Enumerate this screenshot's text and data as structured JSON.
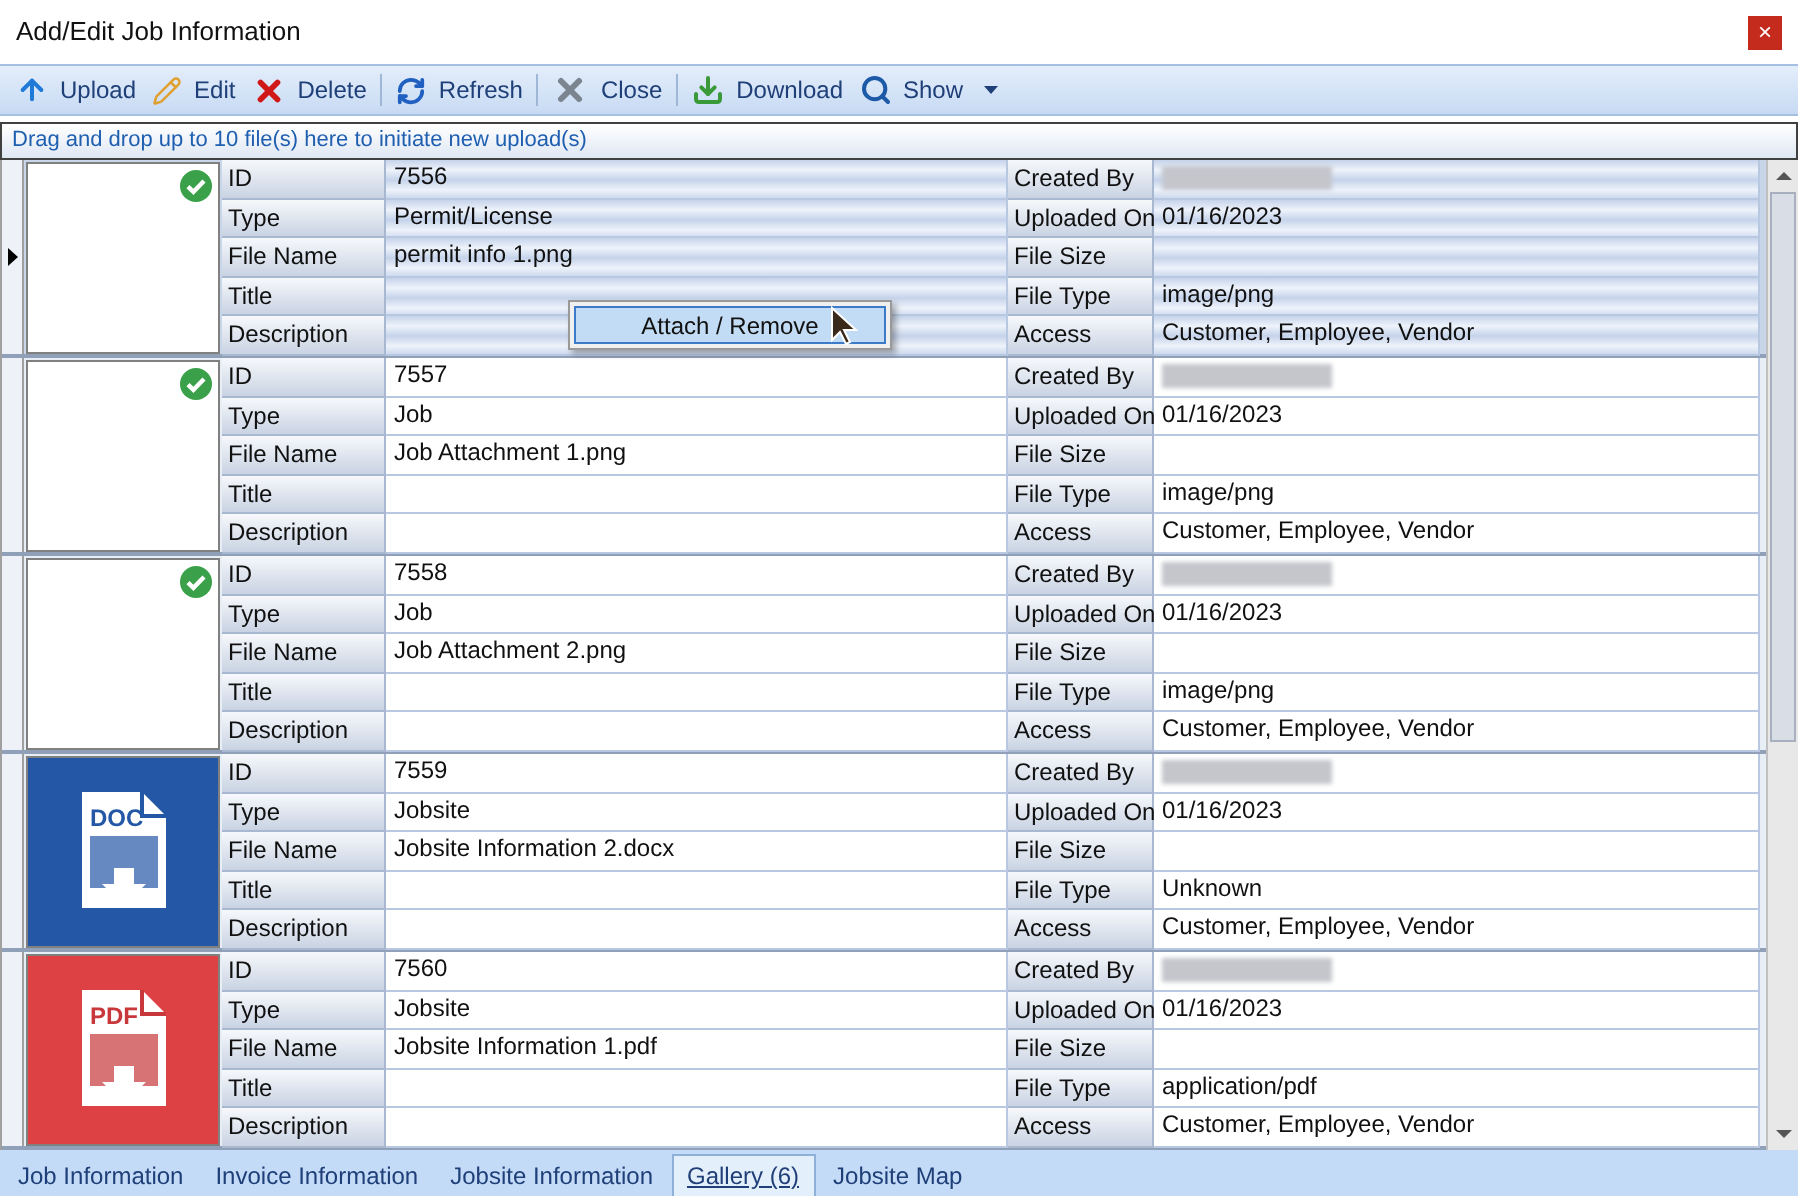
{
  "window": {
    "title": "Add/Edit Job Information",
    "close_glyph": "×"
  },
  "toolbar": {
    "groups": [
      {
        "buttons": [
          {
            "label": "Upload",
            "dropdown": false
          },
          {
            "label": "Edit",
            "dropdown": false
          },
          {
            "label": "Delete",
            "dropdown": false
          }
        ]
      },
      {
        "buttons": [
          {
            "label": "Refresh",
            "dropdown": false
          }
        ]
      },
      {
        "buttons": [
          {
            "label": "Close",
            "dropdown": false
          }
        ]
      },
      {
        "buttons": [
          {
            "label": "Download",
            "dropdown": false
          },
          {
            "label": "Show",
            "dropdown": true
          }
        ]
      }
    ]
  },
  "drop_hint": "Drag and drop up to 10 file(s) here to initiate new upload(s)",
  "records": [
    {
      "selected": true,
      "thumbnail": {
        "kind": "image",
        "attached": true
      },
      "left": [
        {
          "label": "ID",
          "value": "7556"
        },
        {
          "label": "Type",
          "value": "Permit/License"
        },
        {
          "label": "File Name",
          "value": "permit info 1.png"
        },
        {
          "label": "Title"
        },
        {
          "label": "Description"
        }
      ],
      "right": [
        {
          "label": "Created By",
          "redacted": true
        },
        {
          "label": "Uploaded On",
          "value": "01/16/2023"
        },
        {
          "label": "File Size"
        },
        {
          "label": "File Type",
          "value": "image/png"
        },
        {
          "label": "Access",
          "value": "Customer, Employee, Vendor"
        }
      ]
    },
    {
      "selected": false,
      "thumbnail": {
        "kind": "image",
        "attached": true
      },
      "left": [
        {
          "label": "ID",
          "value": "7557"
        },
        {
          "label": "Type",
          "value": "Job"
        },
        {
          "label": "File Name",
          "value": "Job Attachment 1.png"
        },
        {
          "label": "Title"
        },
        {
          "label": "Description"
        }
      ],
      "right": [
        {
          "label": "Created By",
          "redacted": true
        },
        {
          "label": "Uploaded On",
          "value": "01/16/2023"
        },
        {
          "label": "File Size"
        },
        {
          "label": "File Type",
          "value": "image/png"
        },
        {
          "label": "Access",
          "value": "Customer, Employee, Vendor"
        }
      ]
    },
    {
      "selected": false,
      "thumbnail": {
        "kind": "image",
        "attached": true
      },
      "left": [
        {
          "label": "ID",
          "value": "7558"
        },
        {
          "label": "Type",
          "value": "Job"
        },
        {
          "label": "File Name",
          "value": "Job Attachment 2.png"
        },
        {
          "label": "Title"
        },
        {
          "label": "Description"
        }
      ],
      "right": [
        {
          "label": "Created By",
          "redacted": true
        },
        {
          "label": "Uploaded On",
          "value": "01/16/2023"
        },
        {
          "label": "File Size"
        },
        {
          "label": "File Type",
          "value": "image/png"
        },
        {
          "label": "Access",
          "value": "Customer, Employee, Vendor"
        }
      ]
    },
    {
      "selected": false,
      "thumbnail": {
        "kind": "doc",
        "badge": "DOC",
        "attached": false
      },
      "left": [
        {
          "label": "ID",
          "value": "7559"
        },
        {
          "label": "Type",
          "value": "Jobsite"
        },
        {
          "label": "File Name",
          "value": "Jobsite Information 2.docx"
        },
        {
          "label": "Title"
        },
        {
          "label": "Description"
        }
      ],
      "right": [
        {
          "label": "Created By",
          "redacted": true
        },
        {
          "label": "Uploaded On",
          "value": "01/16/2023"
        },
        {
          "label": "File Size"
        },
        {
          "label": "File Type",
          "value": "Unknown"
        },
        {
          "label": "Access",
          "value": "Customer, Employee, Vendor"
        }
      ]
    },
    {
      "selected": false,
      "thumbnail": {
        "kind": "pdf",
        "badge": "PDF",
        "attached": false
      },
      "left": [
        {
          "label": "ID",
          "value": "7560"
        },
        {
          "label": "Type",
          "value": "Jobsite"
        },
        {
          "label": "File Name",
          "value": "Jobsite Information 1.pdf"
        },
        {
          "label": "Title"
        },
        {
          "label": "Description"
        }
      ],
      "right": [
        {
          "label": "Created By",
          "redacted": true
        },
        {
          "label": "Uploaded On",
          "value": "01/16/2023"
        },
        {
          "label": "File Size"
        },
        {
          "label": "File Type",
          "value": "application/pdf"
        },
        {
          "label": "Access",
          "value": "Customer, Employee, Vendor"
        }
      ]
    }
  ],
  "context_menu": {
    "items": [
      "Attach / Remove"
    ]
  },
  "tabs": [
    {
      "label": "Job Information",
      "selected": false
    },
    {
      "label": "Invoice Information",
      "selected": false
    },
    {
      "label": "Jobsite Information",
      "selected": false
    },
    {
      "label": "Gallery (6)",
      "selected": true
    },
    {
      "label": "Jobsite Map",
      "selected": false
    }
  ]
}
